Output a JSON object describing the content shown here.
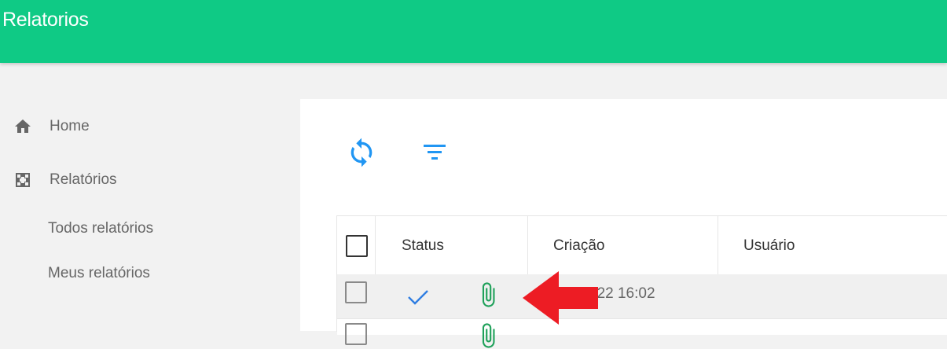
{
  "header": {
    "title": "Relatorios",
    "color": "#0fca85"
  },
  "sidebar": {
    "items": [
      {
        "label": "Home",
        "icon": "home-icon"
      },
      {
        "label": "Relatórios",
        "icon": "reports-icon"
      }
    ],
    "subitems": [
      {
        "label": "Todos relatórios"
      },
      {
        "label": "Meus relatórios"
      }
    ]
  },
  "toolbar": {
    "refresh_icon": "refresh-icon",
    "filter_icon": "filter-icon",
    "icon_color": "#2196f3"
  },
  "table": {
    "columns": [
      "Status",
      "Criação",
      "Usuário"
    ],
    "rows": [
      {
        "status_icon": "check-icon",
        "attachment_icon": "attachment-icon",
        "created": "022 16:02",
        "user": ""
      }
    ]
  },
  "annotation": {
    "icon": "red-arrow-icon",
    "color": "#ed1c24"
  }
}
